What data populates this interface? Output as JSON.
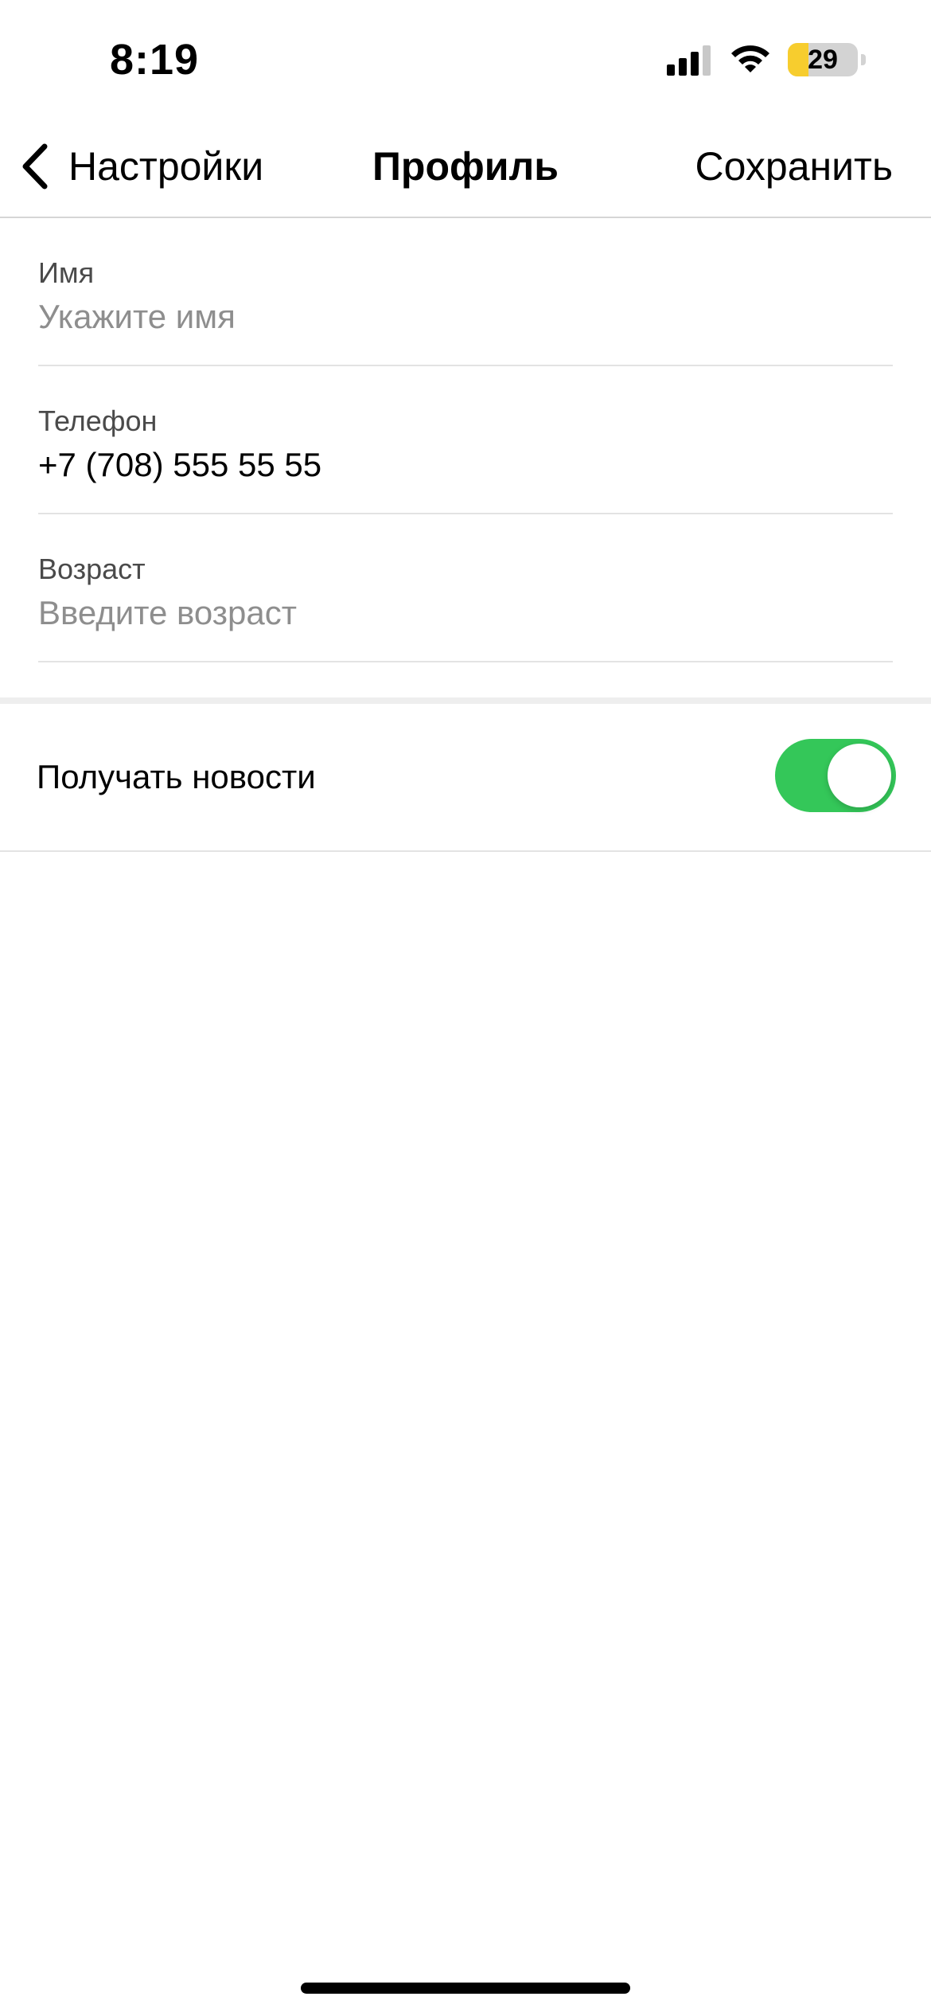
{
  "status_bar": {
    "time": "8:19",
    "battery_level": "29",
    "battery_fraction": 0.29,
    "battery_color": "#f7cd2e",
    "icons": [
      "cellular-signal-icon",
      "wifi-icon",
      "battery-icon"
    ]
  },
  "nav": {
    "back_label": "Настройки",
    "back_icon": "chevron-left-icon",
    "title": "Профиль",
    "save_label": "Сохранить"
  },
  "form": {
    "fields": [
      {
        "label": "Имя",
        "value": "",
        "placeholder": "Укажите имя"
      },
      {
        "label": "Телефон",
        "value": "+7 (708) 555 55 55",
        "placeholder": ""
      },
      {
        "label": "Возраст",
        "value": "",
        "placeholder": "Введите возраст"
      }
    ]
  },
  "toggle": {
    "label": "Получать новости",
    "on": true,
    "color_on": "#34c759"
  }
}
